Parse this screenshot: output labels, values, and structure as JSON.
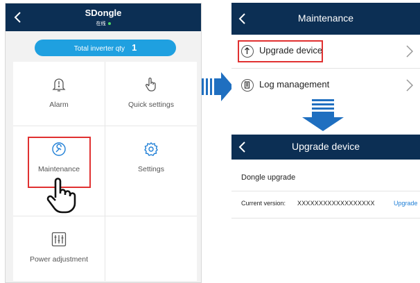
{
  "left_app": {
    "title": "SDongle",
    "status": "在线",
    "total_inverter_label": "Total inverter qty",
    "total_inverter_value": "1",
    "tiles": {
      "alarm": "Alarm",
      "quick_settings": "Quick settings",
      "maintenance": "Maintenance",
      "settings": "Settings",
      "power_adjustment": "Power adjustment"
    }
  },
  "maintenance_screen": {
    "title": "Maintenance",
    "items": [
      "Upgrade device",
      "Log management"
    ]
  },
  "upgrade_screen": {
    "title": "Upgrade device",
    "section": "Dongle upgrade",
    "current_version_label": "Current version:",
    "current_version_value": "XXXXXXXXXXXXXXXXXX",
    "upgrade_link": "Upgrade"
  },
  "colors": {
    "header": "#0c2f54",
    "pill": "#1fa0e0",
    "highlight": "#e03030",
    "arrow": "#1f6fc0",
    "link": "#1f7fd6",
    "online": "#4cd964"
  },
  "icons": {
    "back": "chevron-left-icon",
    "alarm": "bell-icon",
    "quick_settings": "hand-touch-icon",
    "maintenance": "wrench-icon",
    "settings": "gear-icon",
    "power_adjustment": "sliders-icon",
    "upgrade": "upload-arrow-icon",
    "log": "document-icon",
    "chevron": "chevron-right-icon",
    "pointer": "pointing-hand-icon"
  }
}
